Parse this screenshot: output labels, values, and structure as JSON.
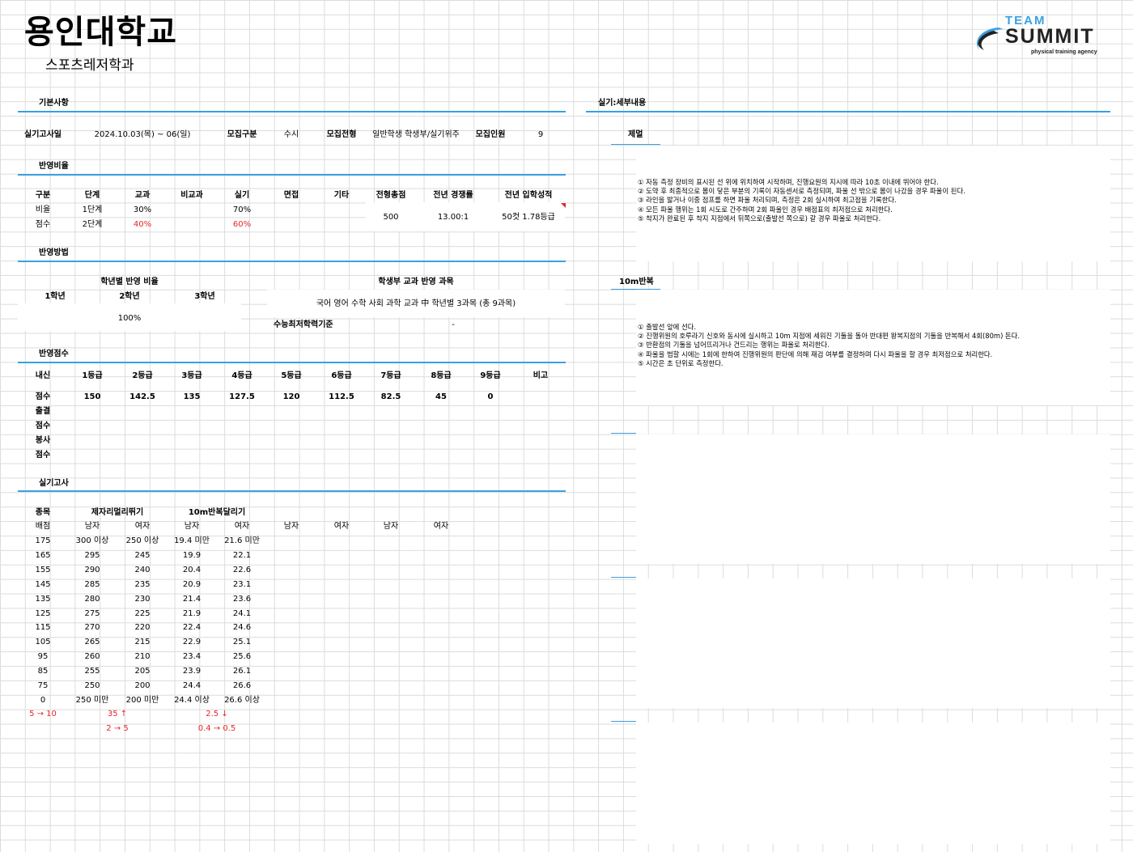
{
  "header": {
    "university": "용인대학교",
    "department": "스포츠레저학과"
  },
  "logo": {
    "line1": "TEAM",
    "line2": "SUMMIT",
    "line3": "physical training agency",
    "color": "#3b9fe0"
  },
  "basic": {
    "section": "기본사항",
    "exam_date_label": "실기고사일",
    "exam_date": "2024.10.03(목) ~ 06(일)",
    "type_label": "모집구분",
    "type": "수시",
    "track_label": "모집전형",
    "track": "일반학생 학생부/실기위주",
    "quota_label": "모집인원",
    "quota": "9"
  },
  "ratio": {
    "section": "반영비율",
    "headers": [
      "구분",
      "단계",
      "교과",
      "비교과",
      "실기",
      "면접",
      "기타",
      "전형총점",
      "전년 경쟁률",
      "전년 입학성적"
    ],
    "row1": {
      "label": "비율",
      "stage": "1단계",
      "subject": "30%",
      "practical": "70%"
    },
    "row2": {
      "label": "점수",
      "stage": "2단계",
      "subject": "40%",
      "practical": "60%"
    },
    "total": "500",
    "competition": "13.00:1",
    "admission": "50컷 1.78등급"
  },
  "method": {
    "section": "반영방법",
    "grade_ratio_title": "학년별 반영 비율",
    "grades": [
      "1학년",
      "2학년",
      "3학년"
    ],
    "grade_ratio": "100%",
    "subjects_title": "학생부 교과 반영 과목",
    "subjects": "국어 영어 수학 사회 과학 교과 中 학년별 3과목 (총 9과목)",
    "csat_label": "수능최저학력기준",
    "csat": "-"
  },
  "score": {
    "section": "반영점수",
    "headers": [
      "내신",
      "1등급",
      "2등급",
      "3등급",
      "4등급",
      "5등급",
      "6등급",
      "7등급",
      "8등급",
      "9등급",
      "비고"
    ],
    "row_label": "점수",
    "values": [
      "150",
      "142.5",
      "135",
      "127.5",
      "120",
      "112.5",
      "82.5",
      "45",
      "0"
    ],
    "extra_rows": [
      "출결",
      "점수",
      "봉사",
      "점수"
    ]
  },
  "practical": {
    "section": "실기고사",
    "event_label": "종목",
    "events": [
      "제자리멀리뛰기",
      "10m반복달리기"
    ],
    "score_label": "배점",
    "genders": [
      "남자",
      "여자",
      "남자",
      "여자",
      "남자",
      "여자",
      "남자",
      "여자"
    ],
    "rows": [
      [
        "175",
        "300 이상",
        "250 이상",
        "19.4 미만",
        "21.6 미만"
      ],
      [
        "165",
        "295",
        "245",
        "19.9",
        "22.1"
      ],
      [
        "155",
        "290",
        "240",
        "20.4",
        "22.6"
      ],
      [
        "145",
        "285",
        "235",
        "20.9",
        "23.1"
      ],
      [
        "135",
        "280",
        "230",
        "21.4",
        "23.6"
      ],
      [
        "125",
        "275",
        "225",
        "21.9",
        "24.1"
      ],
      [
        "115",
        "270",
        "220",
        "22.4",
        "24.6"
      ],
      [
        "105",
        "265",
        "215",
        "22.9",
        "25.1"
      ],
      [
        "95",
        "260",
        "210",
        "23.4",
        "25.6"
      ],
      [
        "85",
        "255",
        "205",
        "23.9",
        "26.1"
      ],
      [
        "75",
        "250",
        "200",
        "24.4",
        "26.6"
      ],
      [
        "0",
        "250 미만",
        "200 미만",
        "24.4 이상",
        "26.6 이상"
      ]
    ],
    "note1": [
      "5 → 10",
      "35 ↑",
      "2.5 ↓"
    ],
    "note2": [
      "2 → 5",
      "0.4 → 0.5"
    ]
  },
  "detail": {
    "section": "실기:세부내용",
    "event1": "제멀",
    "event1_notes": [
      "① 자동 측정 장비의 표시된 선 위에 위치하여 시작하며, 진행요원의 지시에 따라 10초 이내에 뛰어야 한다.",
      "② 도약 후 최종적으로 몸이 닿은 부분의 기록이 자동센서로 측정되며, 파울 선 밖으로 몸이 나갔을 경우 파울이 된다.",
      "③ 라인을 밟거나 이중 점프를 하면 파울 처리되며, 측정은 2회 실시하여 최고점을 기록한다.",
      "④ 모든 파울 행위는 1회 시도로 간주하며 2회 파울인 경우 배점표의 최저점으로 처리한다.",
      "⑤ 착지가 완료된 후 착지 지점에서 뒤쪽으로(출발선 쪽으로) 갈 경우 파울로 처리한다."
    ],
    "event2": "10m반복",
    "event2_notes": [
      "① 출발선 앞에 선다.",
      "② 진행위원의 호루라기 신호와 동시에 실시하고 10m 지점에 세워진 기둘을 돌아 반대편 왕복지점의 기둘을 반복해서 4회(80m) 돈다.",
      "③ 반환점의 기둘을 넘어뜨리거나 건드리는 행위는 파울로 처리한다.",
      "④ 파울을 범할 시에는 1회에 한하여 진행위원의 판단에 의해 재검 여부를 결정하며 다시 파울을 할 경우 최저점으로 처리한다.",
      "⑤ 시간은 초 단위로 측정한다."
    ]
  }
}
